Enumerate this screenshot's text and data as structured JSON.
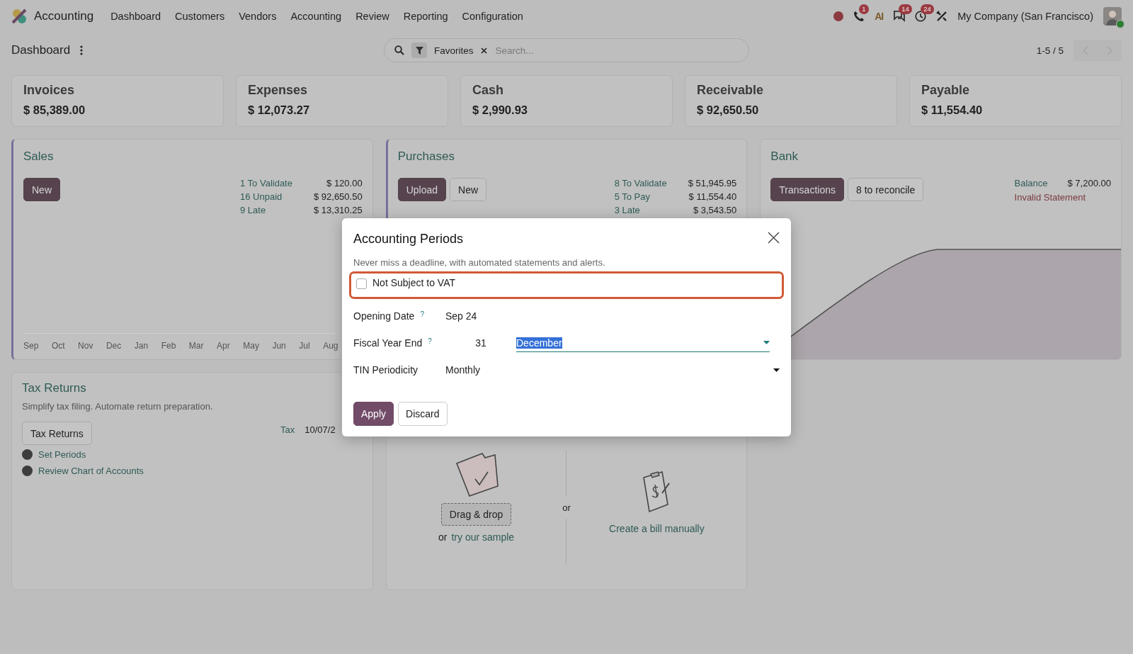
{
  "navbar": {
    "app_name": "Accounting",
    "menu": [
      "Dashboard",
      "Customers",
      "Vendors",
      "Accounting",
      "Review",
      "Reporting",
      "Configuration"
    ],
    "systray": [
      {
        "kind": "record"
      },
      {
        "kind": "phone",
        "badge": "1"
      },
      {
        "kind": "ai",
        "label": "AI"
      },
      {
        "kind": "chat",
        "badge": "14"
      },
      {
        "kind": "clock",
        "badge": "24"
      },
      {
        "kind": "tools"
      }
    ],
    "company": "My Company (San Francisco)"
  },
  "control_panel": {
    "title": "Dashboard",
    "search": {
      "facet": "Favorites",
      "placeholder": "Search..."
    },
    "pager": "1-5 / 5"
  },
  "kpis": [
    {
      "label": "Invoices",
      "value": "$ 85,389.00"
    },
    {
      "label": "Expenses",
      "value": "$ 12,073.27"
    },
    {
      "label": "Cash",
      "value": "$ 2,990.93"
    },
    {
      "label": "Receivable",
      "value": "$ 92,650.50"
    },
    {
      "label": "Payable",
      "value": "$ 11,554.40"
    }
  ],
  "journals": [
    {
      "kind": "sales",
      "title": "Sales",
      "buttons": [
        {
          "label": "New",
          "primary": true
        }
      ],
      "stats": [
        {
          "label": "1 To Validate",
          "amount": "$ 120.00"
        },
        {
          "label": "16 Unpaid",
          "amount": "$ 92,650.50"
        },
        {
          "label": "9 Late",
          "amount": "$ 13,310.25"
        }
      ],
      "months": [
        "Sep",
        "Oct",
        "Nov",
        "Dec",
        "Jan",
        "Feb",
        "Mar",
        "Apr",
        "May",
        "Jun",
        "Jul",
        "Aug"
      ]
    },
    {
      "kind": "purchases",
      "title": "Purchases",
      "buttons": [
        {
          "label": "Upload",
          "primary": true
        },
        {
          "label": "New",
          "primary": false
        }
      ],
      "stats": [
        {
          "label": "8 To Validate",
          "amount": "$ 51,945.95"
        },
        {
          "label": "5 To Pay",
          "amount": "$ 11,554.40"
        },
        {
          "label": "3 Late",
          "amount": "$ 3,543.50"
        }
      ]
    },
    {
      "kind": "bank",
      "title": "Bank",
      "buttons": [
        {
          "label": "Transactions",
          "primary": true
        },
        {
          "label": "8 to reconcile",
          "primary": false
        }
      ],
      "balance_label": "Balance",
      "balance": "$ 7,200.00",
      "warning": "Invalid Statement"
    }
  ],
  "tax_returns": {
    "title": "Tax Returns",
    "subtitle": "Simplify tax filing. Automate return preparation.",
    "button": "Tax Returns",
    "tax_label": "Tax",
    "tax_date": "10/07/2",
    "steps": [
      "Set Periods",
      "Review Chart of Accounts"
    ]
  },
  "upload_card": {
    "drag_label": "Drag & drop",
    "or_text": "or",
    "sample_link": "try our sample",
    "divider_text": "or",
    "manual_link": "Create a bill manually"
  },
  "dialog": {
    "title": "Accounting Periods",
    "description": "Never miss a deadline, with automated statements and alerts.",
    "vat": {
      "label": "Not Subject to VAT",
      "checked": false
    },
    "opening_date": {
      "label": "Opening Date",
      "help": "?",
      "value": "Sep 24"
    },
    "fiscal_year_end": {
      "label": "Fiscal Year End",
      "help": "?",
      "day": "31",
      "month": "December"
    },
    "tin_periodicity": {
      "label": "TIN Periodicity",
      "value": "Monthly"
    },
    "buttons": [
      {
        "label": "Apply",
        "primary": true
      },
      {
        "label": "Discard",
        "primary": false
      }
    ]
  }
}
